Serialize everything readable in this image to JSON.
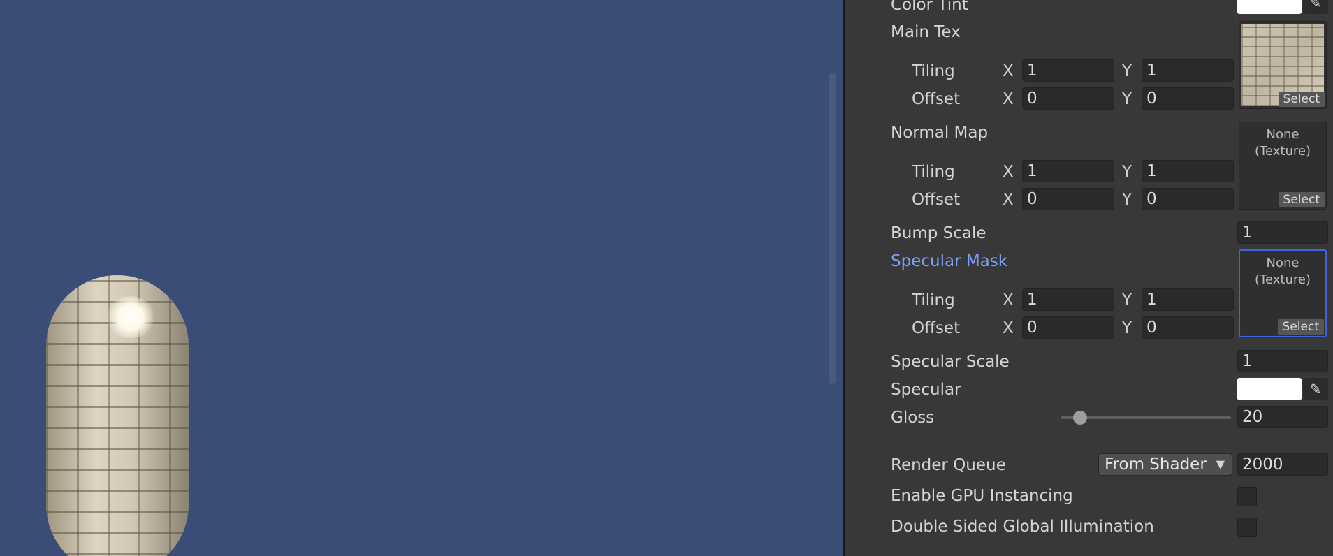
{
  "scene": {},
  "material": {
    "color_tint": {
      "label": "Color Tint",
      "color": "#ffffff",
      "picker_icon": "eyedropper-icon"
    },
    "main_tex": {
      "label": "Main Tex",
      "tiling_label": "Tiling",
      "offset_label": "Offset",
      "x_label": "X",
      "y_label": "Y",
      "tiling": {
        "x": "1",
        "y": "1"
      },
      "offset": {
        "x": "0",
        "y": "0"
      },
      "select_label": "Select"
    },
    "normal_map": {
      "label": "Normal Map",
      "tiling_label": "Tiling",
      "offset_label": "Offset",
      "x_label": "X",
      "y_label": "Y",
      "tiling": {
        "x": "1",
        "y": "1"
      },
      "offset": {
        "x": "0",
        "y": "0"
      },
      "slot_text": "None\n(Texture)",
      "select_label": "Select"
    },
    "bump_scale": {
      "label": "Bump Scale",
      "value": "1"
    },
    "specular_mask": {
      "label": "Specular Mask",
      "tiling_label": "Tiling",
      "offset_label": "Offset",
      "x_label": "X",
      "y_label": "Y",
      "tiling": {
        "x": "1",
        "y": "1"
      },
      "offset": {
        "x": "0",
        "y": "0"
      },
      "slot_text": "None\n(Texture)",
      "select_label": "Select"
    },
    "specular_scale": {
      "label": "Specular Scale",
      "value": "1"
    },
    "specular": {
      "label": "Specular",
      "color": "#ffffff",
      "picker_icon": "eyedropper-icon"
    },
    "gloss": {
      "label": "Gloss",
      "value": "20",
      "slider_fraction": 0.08
    },
    "render_queue": {
      "label": "Render Queue",
      "dropdown": "From Shader",
      "value": "2000"
    },
    "gpu_instancing": {
      "label": "Enable GPU Instancing",
      "checked": false
    },
    "double_sided_gi": {
      "label": "Double Sided Global Illumination",
      "checked": false
    }
  }
}
